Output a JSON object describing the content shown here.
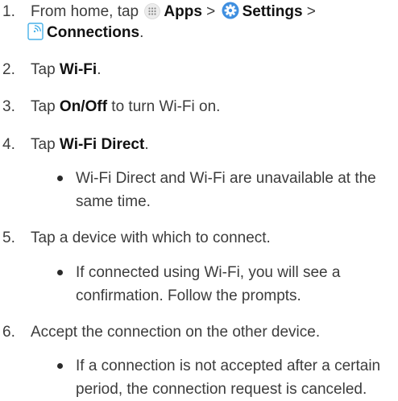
{
  "steps": [
    {
      "num": "1.",
      "lead": "From home, tap",
      "apps_label": "Apps",
      "sep1": ">",
      "settings_label": "Settings",
      "sep2": ">",
      "connections_label": "Connections",
      "end": "."
    },
    {
      "num": "2.",
      "lead": "Tap",
      "bold": "Wi-Fi",
      "end": "."
    },
    {
      "num": "3.",
      "lead": "Tap",
      "bold": "On/Off",
      "end": " to turn Wi-Fi on."
    },
    {
      "num": "4.",
      "lead": "Tap",
      "bold": "Wi-Fi Direct",
      "end": "."
    },
    {
      "num": "5.",
      "text": "Tap a device with which to connect."
    },
    {
      "num": "6.",
      "text": "Accept the connection on the other device."
    }
  ],
  "bullets": {
    "wifi_direct_note": "Wi-Fi Direct and Wi-Fi are unavailable at the same time.",
    "connected_note": "If connected using Wi-Fi, you will see a confirmation. Follow the prompts.",
    "canceled_note": "If a connection is not accepted after a certain period, the connection request is canceled."
  },
  "icons": {
    "apps": "apps-grid-icon",
    "settings": "settings-gear-icon",
    "connections": "connections-icon"
  },
  "colors": {
    "settings_icon_bg": "#3f8fe0",
    "connections_icon": "#48b0e8",
    "apps_icon_bg": "#ececec"
  }
}
